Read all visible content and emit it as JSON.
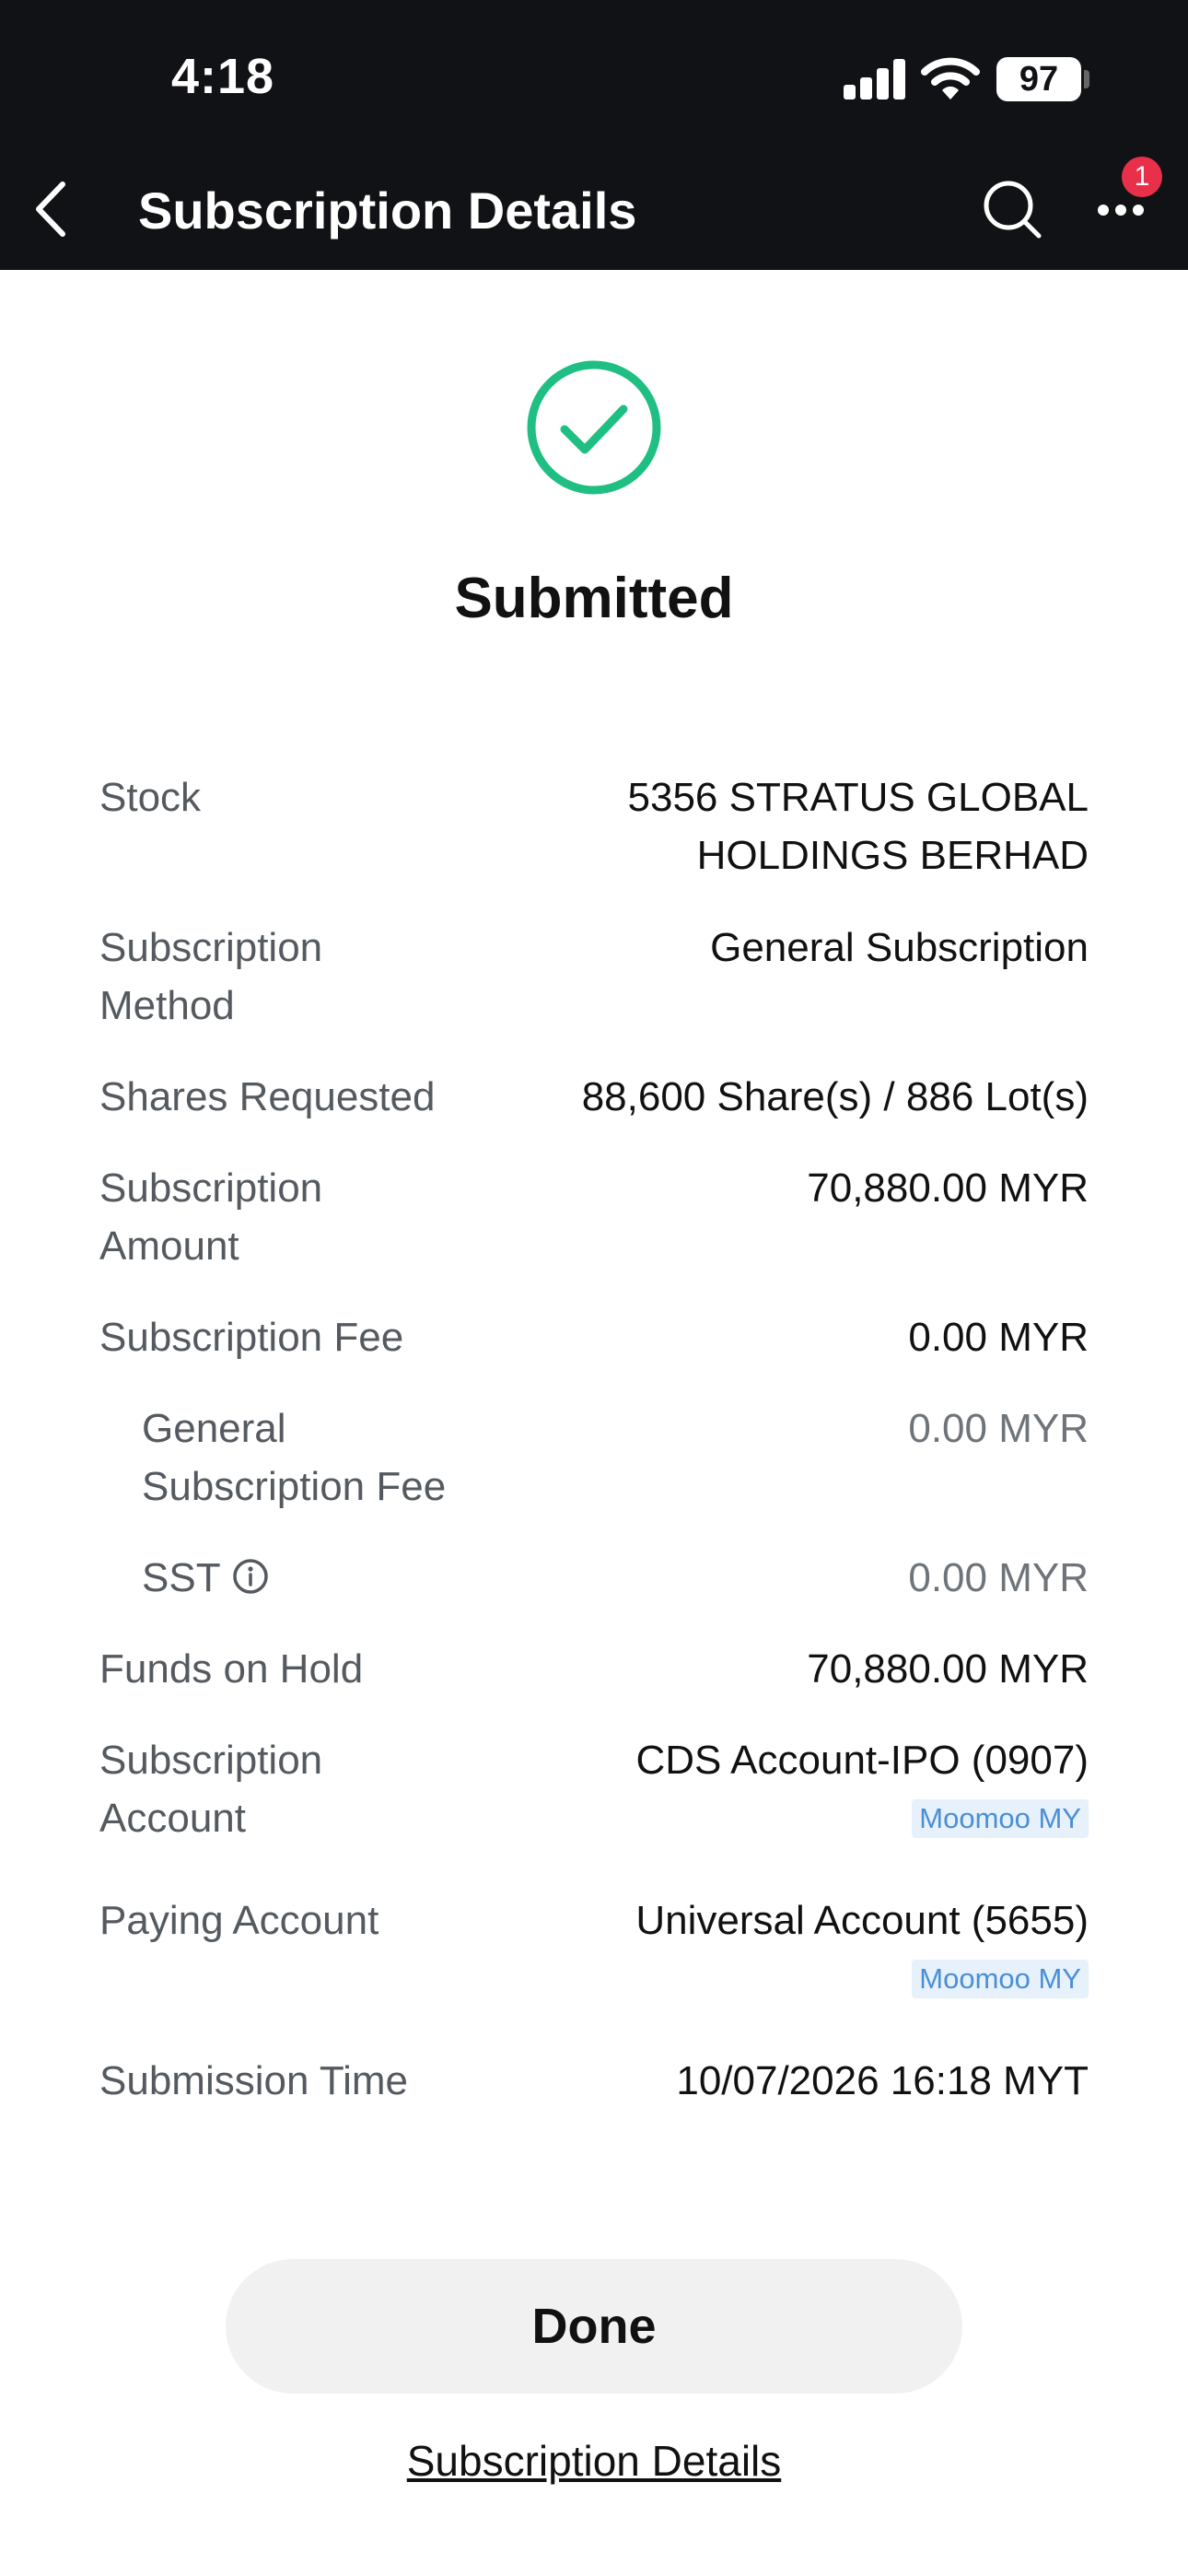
{
  "status_bar": {
    "time": "4:18",
    "battery": "97"
  },
  "nav": {
    "title": "Subscription Details",
    "badge": "1"
  },
  "status": {
    "title": "Submitted"
  },
  "details": {
    "stock": {
      "label": "Stock",
      "value_line1": "5356 STRATUS GLOBAL",
      "value_line2": "HOLDINGS BERHAD"
    },
    "method": {
      "label_line1": "Subscription",
      "label_line2": "Method",
      "value": "General Subscription"
    },
    "shares": {
      "label": "Shares Requested",
      "value": "88,600 Share(s) / 886 Lot(s)"
    },
    "amount": {
      "label_line1": "Subscription",
      "label_line2": "Amount",
      "value": "70,880.00 MYR"
    },
    "fee": {
      "label": "Subscription Fee",
      "value": "0.00 MYR"
    },
    "general_fee": {
      "label_line1": "General",
      "label_line2": "Subscription Fee",
      "value": "0.00 MYR"
    },
    "sst": {
      "label": "SST",
      "value": "0.00 MYR"
    },
    "funds_on_hold": {
      "label": "Funds on Hold",
      "value": "70,880.00 MYR"
    },
    "subscription_account": {
      "label_line1": "Subscription",
      "label_line2": "Account",
      "value": "CDS Account-IPO (0907)",
      "tag": "Moomoo MY"
    },
    "paying_account": {
      "label": "Paying Account",
      "value": "Universal Account (5655)",
      "tag": "Moomoo MY"
    },
    "submission_time": {
      "label": "Submission Time",
      "value": "10/07/2026 16:18 MYT"
    }
  },
  "actions": {
    "done_label": "Done",
    "details_link": "Subscription Details"
  },
  "colors": {
    "success": "#1fbf83",
    "badge": "#e8304a",
    "tag_text": "#4a8fd6",
    "tag_bg": "#e7f1fb"
  }
}
